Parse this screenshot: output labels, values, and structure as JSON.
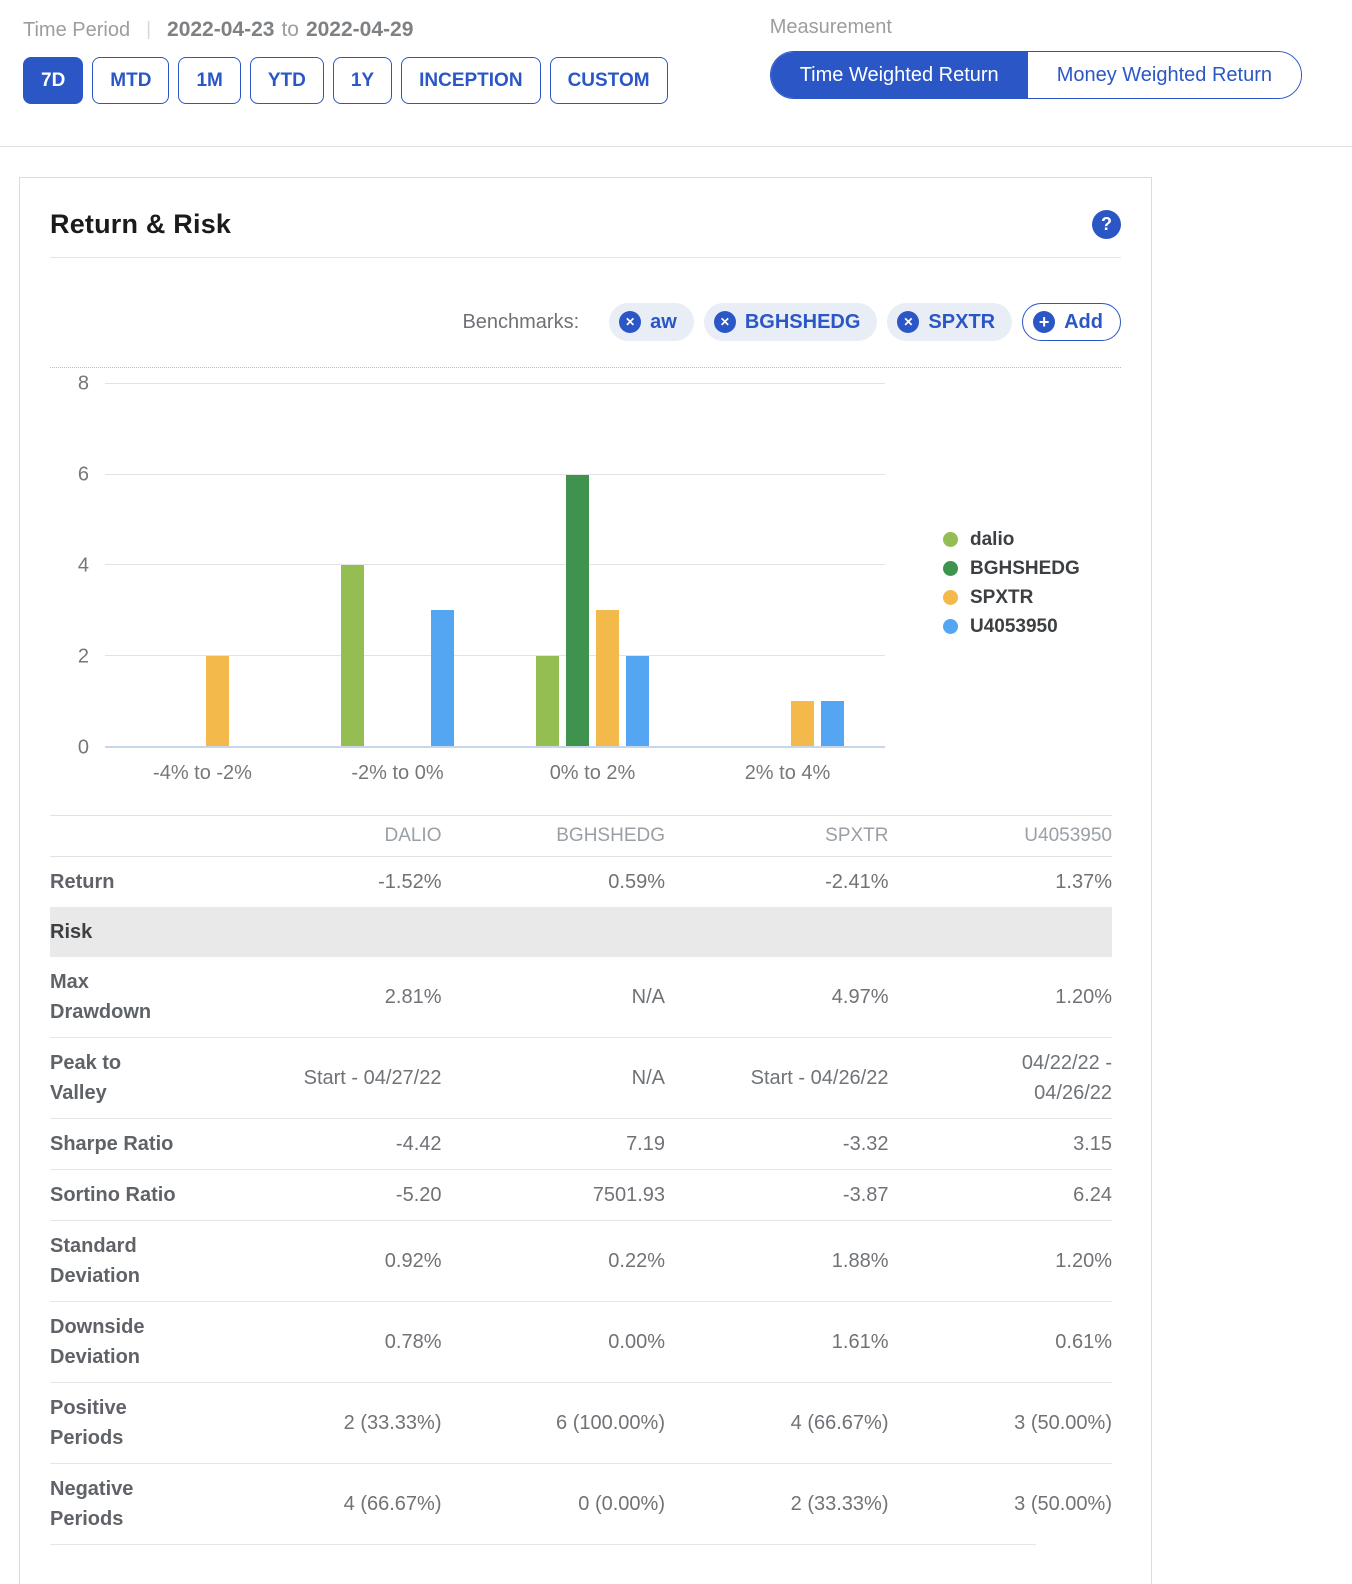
{
  "header": {
    "time_period_label": "Time Period",
    "separator": "|",
    "date_range": {
      "start": "2022-04-23",
      "to": "to",
      "end": "2022-04-29"
    },
    "period_buttons": [
      "7D",
      "MTD",
      "1M",
      "YTD",
      "1Y",
      "INCEPTION",
      "CUSTOM"
    ],
    "active_period": "7D",
    "measurement_label": "Measurement",
    "measurement_options": [
      "Time Weighted Return",
      "Money Weighted Return"
    ],
    "active_measurement": "Time Weighted Return"
  },
  "card": {
    "title": "Return & Risk",
    "help_glyph": "?",
    "benchmarks": {
      "label": "Benchmarks:",
      "chips": [
        "aw",
        "BGHSHEDG",
        "SPXTR"
      ],
      "remove_glyph": "✕",
      "add_glyph": "+",
      "add_label": "Add"
    }
  },
  "chart_data": {
    "type": "bar",
    "categories": [
      "-4% to -2%",
      "-2% to 0%",
      "0% to 2%",
      "2% to 4%"
    ],
    "series": [
      {
        "name": "dalio",
        "color": "#94BD52",
        "values": [
          0,
          4,
          2,
          0
        ]
      },
      {
        "name": "BGHSHEDG",
        "color": "#40934E",
        "values": [
          0,
          0,
          6,
          0
        ]
      },
      {
        "name": "SPXTR",
        "color": "#F3B94A",
        "values": [
          2,
          0,
          3,
          1
        ]
      },
      {
        "name": "U4053950",
        "color": "#55A6F2",
        "values": [
          0,
          3,
          2,
          1
        ]
      }
    ],
    "title": "",
    "xlabel": "",
    "ylabel": "",
    "ylim": [
      0,
      8
    ],
    "yticks": [
      0,
      2,
      4,
      6,
      8
    ],
    "grid": true,
    "legend_position": "right"
  },
  "table": {
    "columns": [
      "",
      "DALIO",
      "BGHSHEDG",
      "SPXTR",
      "U4053950"
    ],
    "rows": [
      {
        "label": "Return",
        "values": [
          "-1.52%",
          "0.59%",
          "-2.41%",
          "1.37%"
        ]
      },
      {
        "label": "Risk",
        "type": "section"
      },
      {
        "label": "Max Drawdown",
        "values": [
          "2.81%",
          "N/A",
          "4.97%",
          "1.20%"
        ]
      },
      {
        "label": "Peak to Valley",
        "values": [
          "Start - 04/27/22",
          "N/A",
          "Start - 04/26/22",
          "04/22/22 -\n04/26/22"
        ]
      },
      {
        "label": "Sharpe Ratio",
        "values": [
          "-4.42",
          "7.19",
          "-3.32",
          "3.15"
        ]
      },
      {
        "label": "Sortino Ratio",
        "values": [
          "-5.20",
          "7501.93",
          "-3.87",
          "6.24"
        ]
      },
      {
        "label": "Standard Deviation",
        "values": [
          "0.92%",
          "0.22%",
          "1.88%",
          "1.20%"
        ]
      },
      {
        "label": "Downside Deviation",
        "values": [
          "0.78%",
          "0.00%",
          "1.61%",
          "0.61%"
        ]
      },
      {
        "label": "Positive Periods",
        "values": [
          "2 (33.33%)",
          "6 (100.00%)",
          "4 (66.67%)",
          "3 (50.00%)"
        ]
      },
      {
        "label": "Negative Periods",
        "values": [
          "4 (66.67%)",
          "0 (0.00%)",
          "2 (33.33%)",
          "3 (50.00%)"
        ]
      }
    ]
  },
  "colors": {
    "primary_blue": "#2B57C6",
    "chip_background": "#E8EDF6",
    "risk_band": "#E9E9E9",
    "axis_baseline": "#C6D6EB",
    "gridline": "#E3E3E3"
  }
}
